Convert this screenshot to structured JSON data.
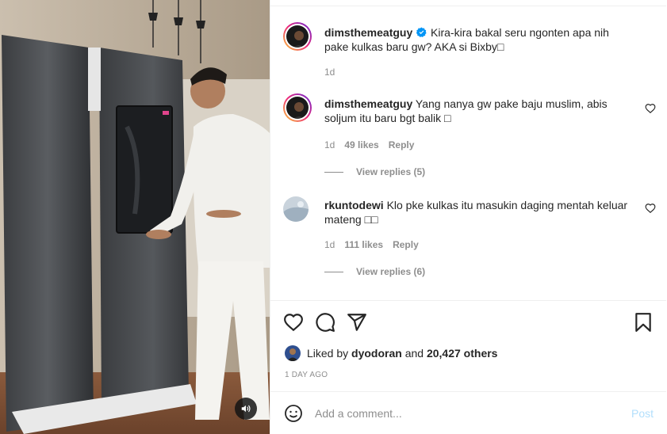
{
  "post": {
    "caption": {
      "username": "dimsthemeatguy",
      "verified": true,
      "text": "Kira-kira bakal seru ngonten apa nih pake kulkas baru gw? AKA si Bixby□",
      "time": "1d"
    },
    "comments": [
      {
        "username": "dimsthemeatguy",
        "text": "Yang nanya gw pake baju muslim, abis soljum itu baru bgt balik □",
        "time": "1d",
        "likes": "49 likes",
        "reply_label": "Reply",
        "view_replies": "View replies (5)"
      },
      {
        "username": "rkuntodewi",
        "text": "Klo pke kulkas itu masukin daging mentah keluar mateng □□",
        "time": "1d",
        "likes": "111 likes",
        "reply_label": "Reply",
        "view_replies": "View replies (6)"
      }
    ],
    "liked_by": {
      "prefix": "Liked by",
      "user": "dyodoran",
      "middle": "and",
      "count": "20,427 others"
    },
    "date": "1 DAY AGO",
    "add_comment": {
      "placeholder": "Add a comment...",
      "post_label": "Post"
    }
  },
  "icons": {
    "like": "heart-icon",
    "comment": "comment-icon",
    "share": "paper-plane-icon",
    "save": "bookmark-icon",
    "emoji": "smiley-icon",
    "sound": "speaker-icon",
    "verified": "verified-badge-icon"
  },
  "colors": {
    "text": "#262626",
    "muted": "#8e8e8e",
    "verified": "#0095f6",
    "post_disabled": "#b2dffc",
    "divider": "#efefef"
  }
}
